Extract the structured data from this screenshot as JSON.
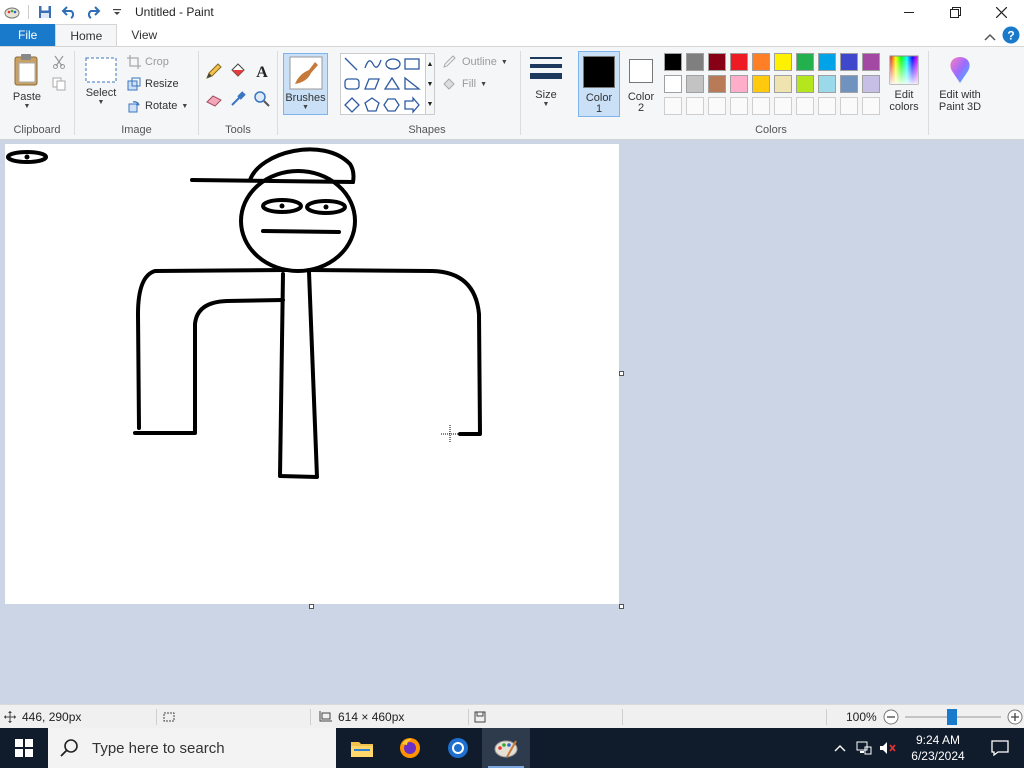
{
  "window": {
    "title": "Untitled - Paint"
  },
  "tabs": [
    {
      "label": "File"
    },
    {
      "label": "Home"
    },
    {
      "label": "View"
    }
  ],
  "ribbon": {
    "clipboard": {
      "label": "Clipboard",
      "paste": "Paste"
    },
    "image": {
      "label": "Image",
      "select": "Select",
      "crop": "Crop",
      "resize": "Resize",
      "rotate": "Rotate"
    },
    "tools": {
      "label": "Tools"
    },
    "brushes": {
      "label": "Brushes"
    },
    "shapes": {
      "label": "Shapes",
      "outline": "Outline",
      "fill": "Fill"
    },
    "size": {
      "label": "Size"
    },
    "color1": {
      "label": "Color",
      "num": "1",
      "value": "#000000"
    },
    "color2": {
      "label": "Color",
      "num": "2",
      "value": "#ffffff"
    },
    "colors": {
      "label": "Colors",
      "edit_colors_line1": "Edit",
      "edit_colors_line2": "colors",
      "row1": [
        "#000000",
        "#7f7f7f",
        "#880015",
        "#ed1c24",
        "#ff7f27",
        "#fff200",
        "#22b14c",
        "#00a2e8",
        "#3f48cc",
        "#a349a4"
      ],
      "row2": [
        "#ffffff",
        "#c3c3c3",
        "#b97a57",
        "#ffaec9",
        "#ffc90e",
        "#efe4b0",
        "#b5e61d",
        "#99d9ea",
        "#7092be",
        "#c8bfe7"
      ]
    },
    "paint3d": {
      "line1": "Edit with",
      "line2": "Paint 3D"
    }
  },
  "statusbar": {
    "cursor_pos": "446, 290px",
    "canvas_size": "614 × 460px",
    "zoom": "100%"
  },
  "taskbar": {
    "search_placeholder": "Type here to search",
    "time": "9:24 AM",
    "date": "6/23/2024"
  }
}
